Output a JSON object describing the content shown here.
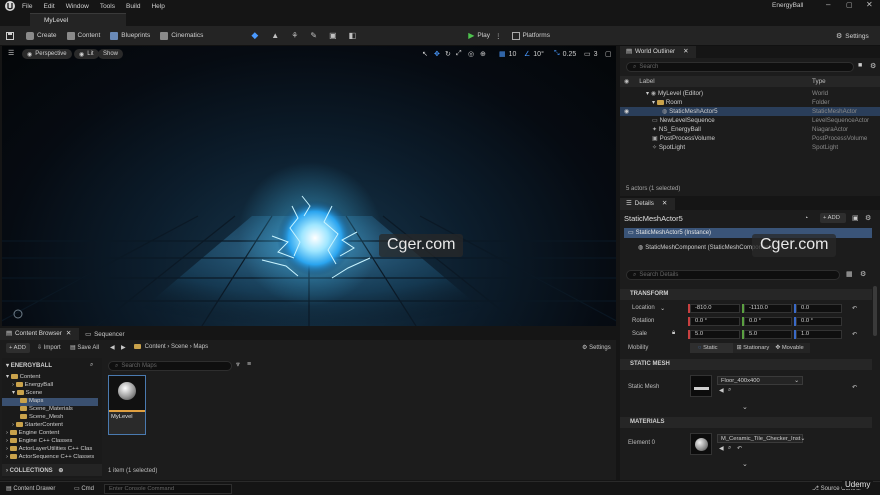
{
  "menubar": {
    "items": [
      "File",
      "Edit",
      "Window",
      "Tools",
      "Build",
      "Help"
    ],
    "project_name": "EnergyBall"
  },
  "document_tab": {
    "label": "MyLevel"
  },
  "toolbar": {
    "create": "Create",
    "content": "Content",
    "blueprints": "Blueprints",
    "cinematics": "Cinematics",
    "play": "Play",
    "platforms": "Platforms",
    "settings": "Settings"
  },
  "viewport": {
    "perspective": "Perspective",
    "lit": "Lit",
    "show": "Show",
    "grid_snap": "10",
    "rotation_snap": "10°",
    "scale_snap": "0.25",
    "camera_speed": "3"
  },
  "watermark": "Cger.com",
  "outliner": {
    "tab": "World Outliner",
    "search_placeholder": "Search",
    "col_label": "Label",
    "col_type": "Type",
    "rows": [
      {
        "label": "MyLevel (Editor)",
        "type": "World"
      },
      {
        "label": "Room",
        "type": "Folder"
      },
      {
        "label": "StaticMeshActor5",
        "type": "StaticMeshActor"
      },
      {
        "label": "NewLevelSequence",
        "type": "LevelSequenceActor"
      },
      {
        "label": "NS_EnergyBall",
        "type": "NiagaraActor"
      },
      {
        "label": "PostProcessVolume",
        "type": "PostProcessVolume"
      },
      {
        "label": "SpotLight",
        "type": "SpotLight"
      }
    ],
    "footer": "5 actors (1 selected)"
  },
  "details": {
    "tab": "Details",
    "actor_name": "StaticMeshActor5",
    "add_label": "+ ADD",
    "instance_label": "StaticMeshActor5 (Instance)",
    "component_label": "StaticMeshComponent (StaticMeshComponent)",
    "search_placeholder": "Search Details",
    "transform": {
      "header": "TRANSFORM",
      "location_label": "Location",
      "location": [
        "-810.0",
        "-1110.0",
        "0.0"
      ],
      "rotation_label": "Rotation",
      "rotation": [
        "0.0 °",
        "0.0 °",
        "0.0 °"
      ],
      "scale_label": "Scale",
      "scale": [
        "5.0",
        "5.0",
        "1.0"
      ],
      "mobility_label": "Mobility",
      "mobility_options": [
        "Static",
        "Stationary",
        "Movable"
      ]
    },
    "static_mesh": {
      "header": "STATIC MESH",
      "prop_label": "Static Mesh",
      "value": "Floor_400x400"
    },
    "materials": {
      "header": "MATERIALS",
      "prop_label": "Element 0",
      "value": "M_Ceramic_Tile_Checker_Inst"
    }
  },
  "content_browser": {
    "tab1": "Content Browser",
    "tab2": "Sequencer",
    "add_label": "+ ADD",
    "import_label": "Import",
    "save_all_label": "Save All",
    "breadcrumb": [
      "Content",
      "Scene",
      "Maps"
    ],
    "settings_label": "Settings",
    "root_label": "ENERGYBALL",
    "tree": [
      {
        "label": "Content",
        "depth": 0
      },
      {
        "label": "EnergyBall",
        "depth": 1
      },
      {
        "label": "Scene",
        "depth": 1
      },
      {
        "label": "Maps",
        "depth": 2
      },
      {
        "label": "Scene_Materials",
        "depth": 2
      },
      {
        "label": "Scene_Mesh",
        "depth": 2
      },
      {
        "label": "StarterContent",
        "depth": 1
      },
      {
        "label": "Engine Content",
        "depth": 0
      },
      {
        "label": "Engine C++ Classes",
        "depth": 0
      },
      {
        "label": "ActorLayerUtilities C++ Clas",
        "depth": 0
      },
      {
        "label": "ActorSequence C++ Classes",
        "depth": 0
      }
    ],
    "collections_label": "COLLECTIONS",
    "search_placeholder": "Search Maps",
    "asset_name": "MyLevel",
    "item_count": "1 item (1 selected)"
  },
  "statusbar": {
    "content_drawer": "Content Drawer",
    "cmd": "Cmd",
    "console_placeholder": "Enter Console Command",
    "source_control": "Source Control",
    "udemy": "Udemy"
  }
}
